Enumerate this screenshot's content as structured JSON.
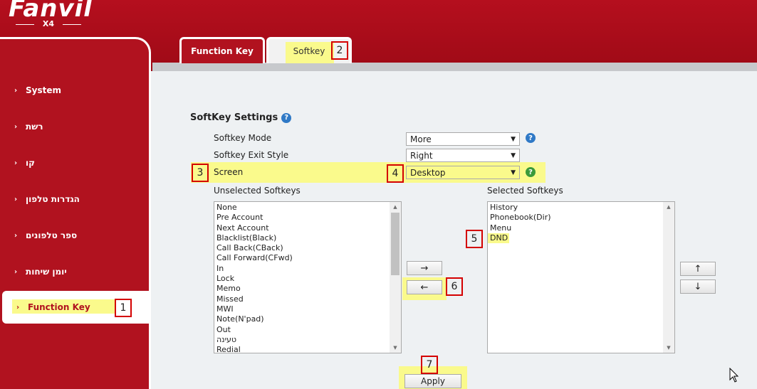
{
  "brand": {
    "logo": "Fanvil",
    "model": "X4"
  },
  "sidebar": {
    "items": [
      {
        "label": "System"
      },
      {
        "label": "רשת"
      },
      {
        "label": "קו"
      },
      {
        "label": "הגדרות טלפון"
      },
      {
        "label": "ספר טלפונים"
      },
      {
        "label": "יומן שיחות"
      },
      {
        "label": "Function Key"
      }
    ],
    "active_index": 6
  },
  "tabs": [
    {
      "label": "Function Key",
      "active": true
    },
    {
      "label": "Softkey",
      "active": false
    }
  ],
  "annotations": [
    "1",
    "2",
    "3",
    "4",
    "5",
    "6",
    "7"
  ],
  "softkey_settings": {
    "title": "SoftKey Settings",
    "rows": [
      {
        "label": "Softkey Mode",
        "value": "More"
      },
      {
        "label": "Softkey Exit Style",
        "value": "Right"
      },
      {
        "label": "Screen",
        "value": "Desktop"
      }
    ]
  },
  "unselected": {
    "label": "Unselected Softkeys",
    "items": [
      "None",
      "Pre Account",
      "Next Account",
      "Blacklist(Black)",
      "Call Back(CBack)",
      "Call Forward(CFwd)",
      "In",
      "Lock",
      "Memo",
      "Missed",
      "MWI",
      "Note(N'pad)",
      "Out",
      "טעינה",
      "Redial"
    ]
  },
  "selected": {
    "label": "Selected Softkeys",
    "items": [
      "History",
      "Phonebook(Dir)",
      "Menu",
      "DND"
    ]
  },
  "buttons": {
    "move_right": "→",
    "move_left": "←",
    "move_up": "↑",
    "move_down": "↓",
    "apply": "Apply"
  },
  "icons": {
    "help": "?",
    "chevron": "›",
    "dropdown": "▼",
    "scroll_up": "▲",
    "scroll_down": "▼"
  },
  "colors": {
    "brand_red": "#b1121f",
    "highlight_yellow": "#fafa8c",
    "annotation_red": "#d40000",
    "help_blue": "#2f79c6",
    "help_green": "#3a9a3a"
  }
}
